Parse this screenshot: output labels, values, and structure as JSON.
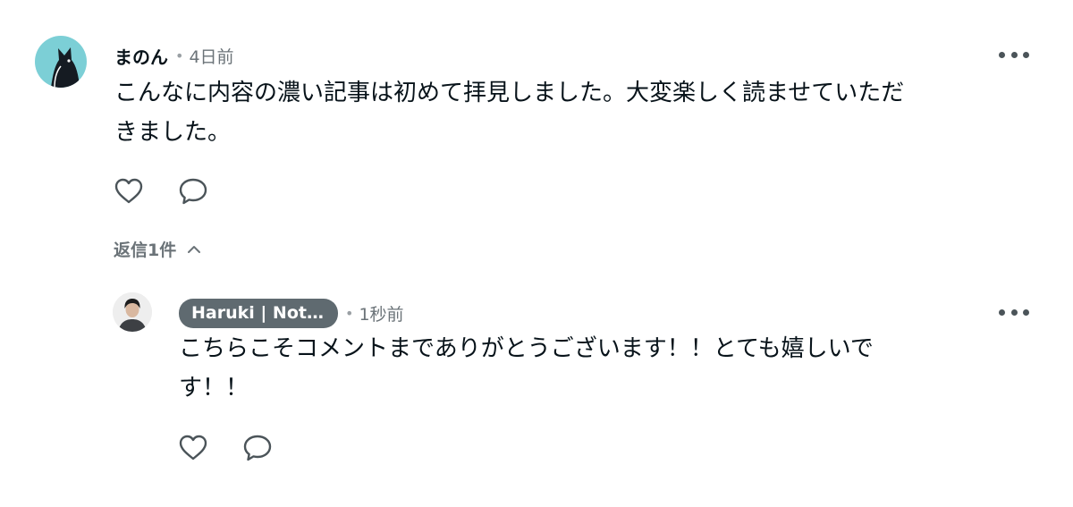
{
  "comment": {
    "author": "まのん",
    "time": "4日前",
    "text_line1": "こんなに内容の濃い記事は初めて拝見しました。大変楽しく読ませていただ",
    "text_line2": "きました。",
    "avatar_icon": "cat-avatar-icon",
    "avatar_color": "#7ccfd6"
  },
  "replies_toggle": {
    "label": "返信1件",
    "icon": "chevron-up-icon"
  },
  "reply": {
    "author": "Haruki | Noti...",
    "time": "1秒前",
    "text_line1": "こちらこそコメントまでありがとうございます！！とても嬉しいで",
    "text_line2": "す！！",
    "avatar_icon": "person-avatar-icon",
    "badge_color": "#5f6a70"
  },
  "icons": {
    "like": "heart-icon",
    "comment": "speech-bubble-icon",
    "more": "more-dots-icon"
  },
  "colors": {
    "text": "#08131a",
    "muted": "#6b7378",
    "icon": "#4b5459"
  }
}
